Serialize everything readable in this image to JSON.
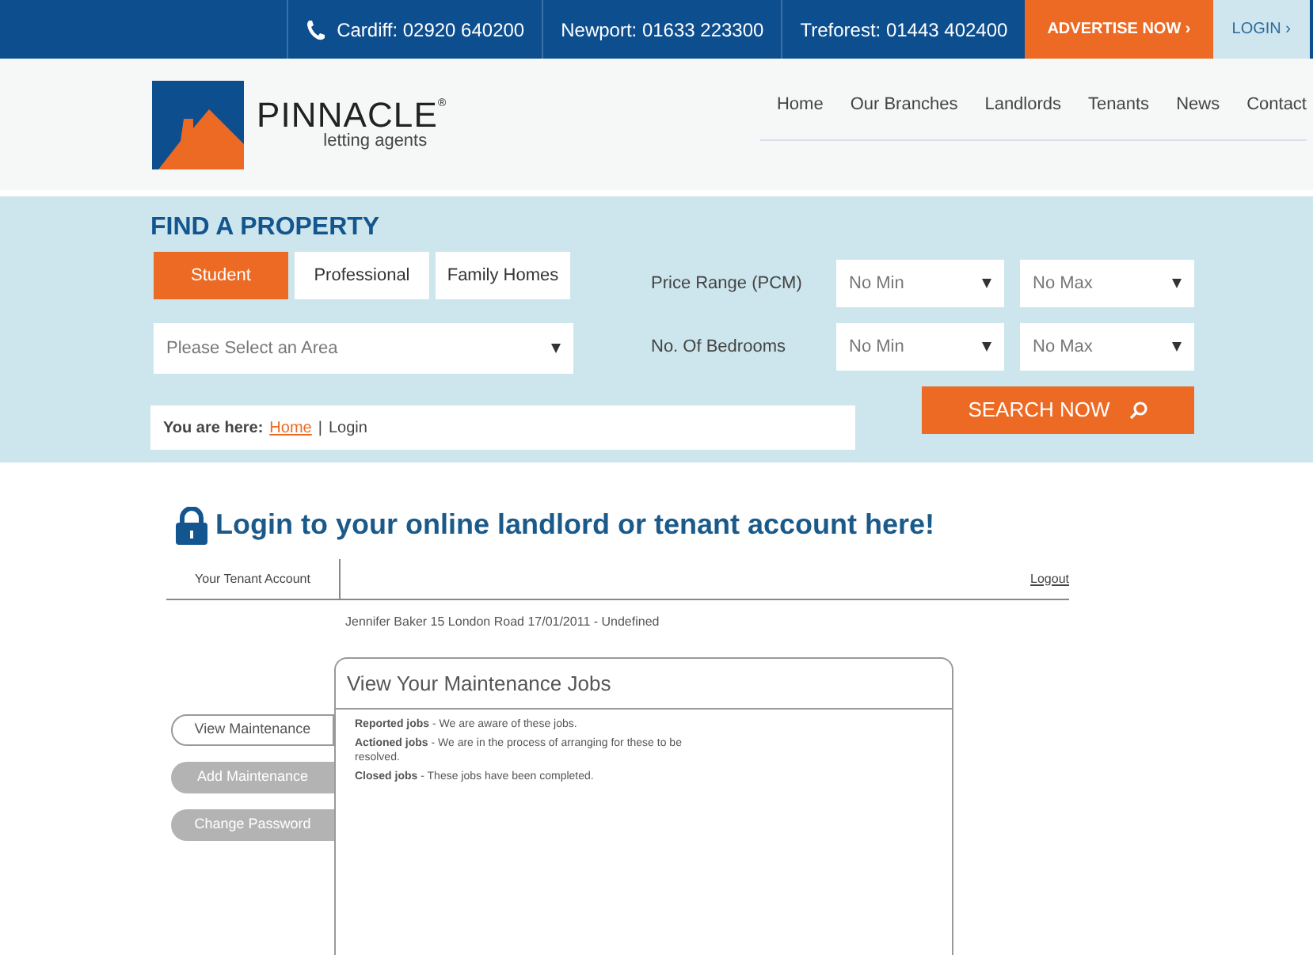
{
  "top_bar": {
    "phones": [
      "Cardiff: 02920 640200",
      "Newport: 01633 223300",
      "Treforest: 01443 402400"
    ],
    "advertise": "ADVERTISE NOW ›",
    "login": "LOGIN ›"
  },
  "logo": {
    "name": "PINNACLE",
    "mark": "®",
    "tagline": "letting agents"
  },
  "nav": [
    "Home",
    "Our Branches",
    "Landlords",
    "Tenants",
    "News",
    "Contact"
  ],
  "search": {
    "title": "FIND A PROPERTY",
    "tabs": [
      {
        "label": "Student",
        "selected": true
      },
      {
        "label": "Professional",
        "selected": false
      },
      {
        "label": "Family Homes",
        "selected": false
      }
    ],
    "area": "Please Select an Area",
    "filters": [
      {
        "label": "Price Range (PCM)",
        "min": "No Min",
        "max": "No Max"
      },
      {
        "label": "No. Of Bedrooms",
        "min": "No Min",
        "max": "No Max"
      }
    ],
    "button": "SEARCH NOW"
  },
  "breadcrumb": {
    "prefix": "You are here:",
    "link": "Home",
    "separator": "|",
    "current": "Login"
  },
  "heading": "Login to your online landlord or tenant account here!",
  "account_tab": "Your Tenant Account",
  "logout": "Logout",
  "tenant_info": "Jennifer Baker 15 London Road 17/01/2011 - Undefined",
  "side_buttons": [
    {
      "label": "View Maintenance",
      "selected": true
    },
    {
      "label": "Add Maintenance",
      "selected": false
    },
    {
      "label": "Change Password",
      "selected": false
    }
  ],
  "panel": {
    "title": "View Your Maintenance Jobs",
    "lines": [
      "**Reported jobs** - We are aware of these jobs.",
      "**Actioned jobs** - We are in the process of arranging for these to be resolved.",
      "**Closed jobs** - These jobs have been completed."
    ]
  }
}
